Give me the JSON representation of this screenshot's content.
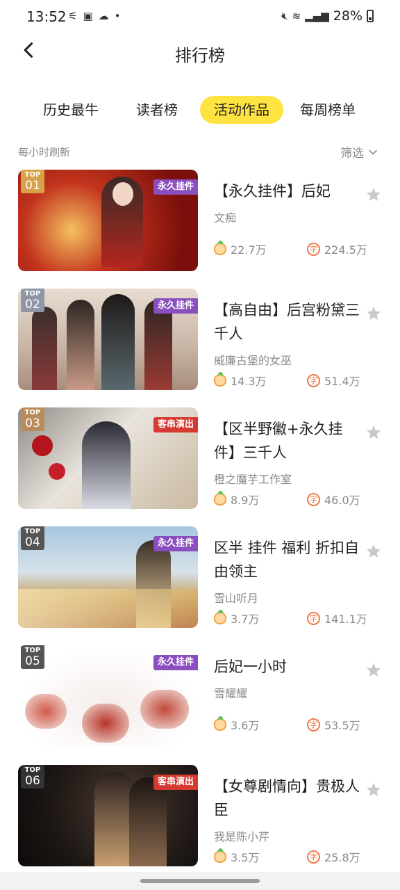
{
  "status_bar": {
    "time": "13:52",
    "battery": "28%",
    "left_icons": [
      "notification-icon",
      "image-icon",
      "cloud-icon",
      "dot-icon"
    ],
    "right_icons": [
      "mute-icon",
      "wifi-icon",
      "signal-icon",
      "battery-icon"
    ]
  },
  "header": {
    "title": "排行榜",
    "back_icon": "chevron-left-icon"
  },
  "tabs": [
    {
      "label": "历史最牛",
      "active": false
    },
    {
      "label": "读者榜",
      "active": false
    },
    {
      "label": "活动作品",
      "active": true
    },
    {
      "label": "每周榜单",
      "active": false
    }
  ],
  "subbar": {
    "refresh_note": "每小时刷新",
    "filter_label": "筛选",
    "filter_icon": "chevron-down-icon"
  },
  "colors": {
    "accent": "#ffe341",
    "gold_badge": "#d9a24a",
    "silver_badge": "#8f96a8",
    "bronze_badge": "#b98a5a",
    "gray_badge": "#555555"
  },
  "items": [
    {
      "rank_label": "TOP",
      "rank": "01",
      "tag": "永久挂件",
      "title": "【永久挂件】后妃",
      "author": "文痴",
      "likes": "22.7万",
      "words": "224.5万"
    },
    {
      "rank_label": "TOP",
      "rank": "02",
      "tag": "永久挂件",
      "title": "【高自由】后宫粉黛三千人",
      "author": "威廉古堡的女巫",
      "likes": "14.3万",
      "words": "51.4万"
    },
    {
      "rank_label": "TOP",
      "rank": "03",
      "tag": "客串演出",
      "title": "【区半野徽+永久挂件】三千人",
      "author": "橙之魔芋工作室",
      "likes": "8.9万",
      "words": "46.0万"
    },
    {
      "rank_label": "TOP",
      "rank": "04",
      "tag": "永久挂件",
      "title": "区半 挂件 福利 折扣自由领主",
      "author": "雪山听月",
      "likes": "3.7万",
      "words": "141.1万"
    },
    {
      "rank_label": "TOP",
      "rank": "05",
      "tag": "永久挂件",
      "title": "后妃一小时",
      "author": "雪耀耀",
      "likes": "3.6万",
      "words": "53.5万"
    },
    {
      "rank_label": "TOP",
      "rank": "06",
      "tag": "客串演出",
      "title": "【女尊剧情向】贵极人臣",
      "author": "我是陈小芹",
      "likes": "3.5万",
      "words": "25.8万"
    }
  ]
}
